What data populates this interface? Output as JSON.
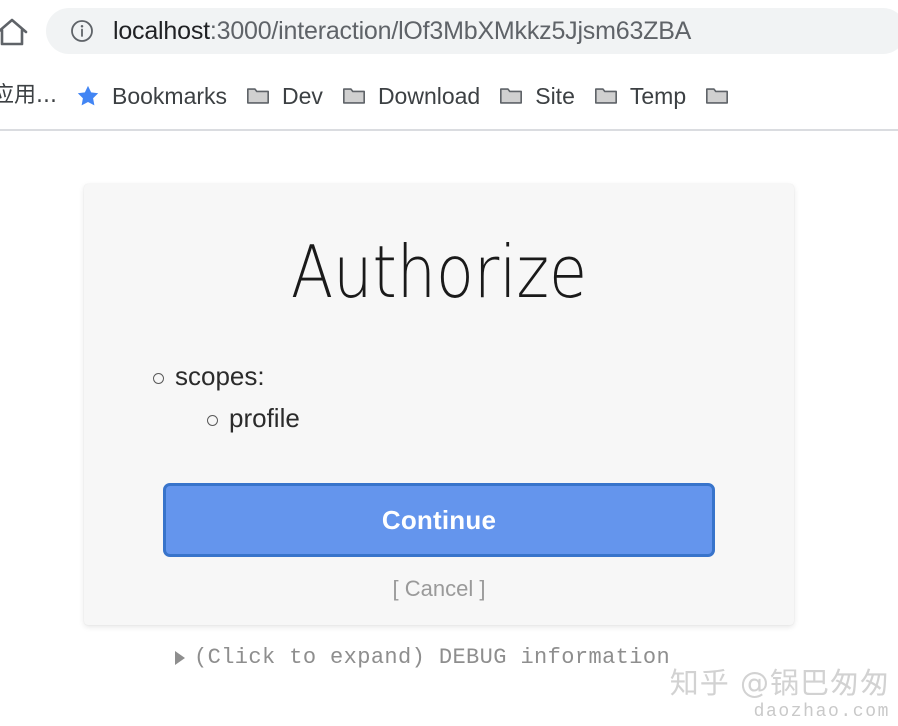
{
  "browser": {
    "home_icon": "home-icon",
    "omnibox": {
      "info_icon": "info-circle-icon",
      "host": "localhost",
      "path": ":3000/interaction/lOf3MbXMkkz5Jjsm63ZBA",
      "full_url": "localhost:3000/interaction/lOf3MbXMkkz5Jjsm63ZBA",
      "background": "#f1f3f4"
    },
    "bookmarks": [
      {
        "label": "应用...",
        "icon": "apps-icon",
        "cjk": true
      },
      {
        "label": "Bookmarks",
        "icon": "star-icon",
        "cjk": false
      },
      {
        "label": "Dev",
        "icon": "folder-icon",
        "cjk": false
      },
      {
        "label": "Download",
        "icon": "folder-icon",
        "cjk": false
      },
      {
        "label": "Site",
        "icon": "folder-icon",
        "cjk": false
      },
      {
        "label": "Temp",
        "icon": "folder-icon",
        "cjk": false
      },
      {
        "label": "",
        "icon": "folder-icon",
        "cjk": false
      }
    ]
  },
  "card": {
    "title": "Authorize",
    "scopes_label": "scopes:",
    "scopes": [
      "profile"
    ],
    "continue_label": "Continue",
    "cancel_label": "[ Cancel ]",
    "background": "#f7f7f7",
    "button_fill": "#6495ed",
    "button_border": "#3874cb"
  },
  "debug": {
    "toggle_text": "(Click to expand) DEBUG information",
    "expanded": false,
    "triangle_icon": "disclosure-triangle-collapsed-icon"
  },
  "watermark": {
    "main": "知乎 @锅巴匆匆",
    "sub": "daozhao.com"
  }
}
